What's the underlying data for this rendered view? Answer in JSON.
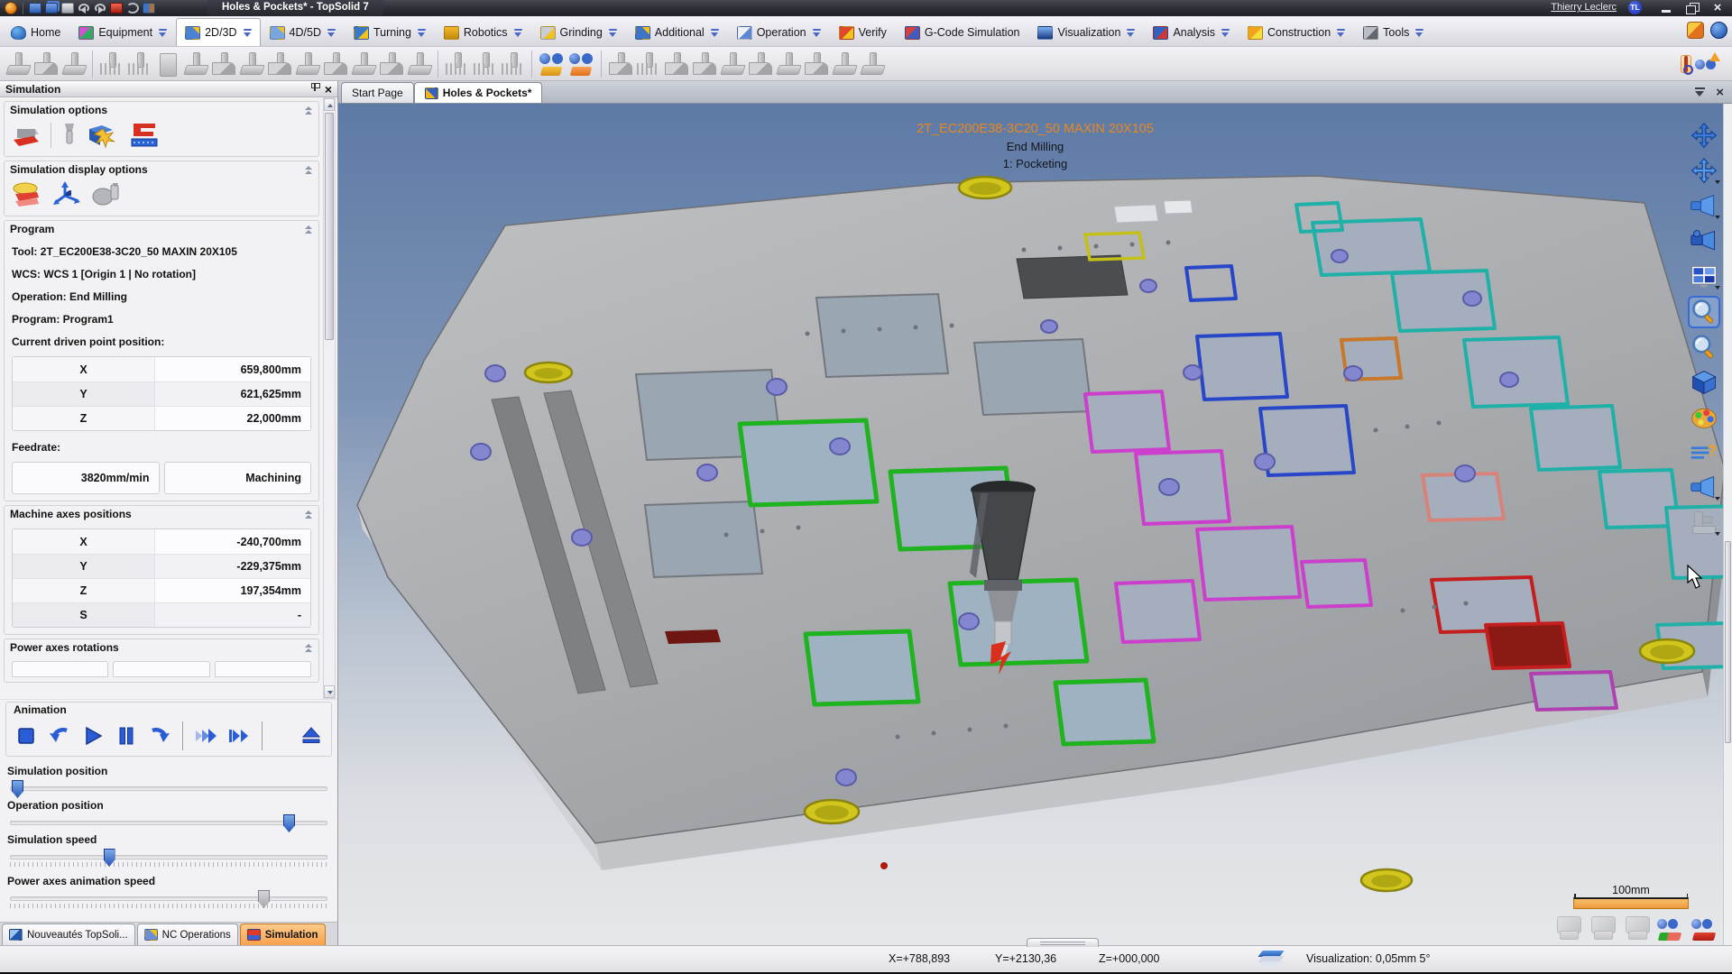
{
  "window": {
    "title": "Holes & Pockets* - TopSolid 7",
    "user_name": "Thierry Leclerc",
    "user_initials": "TL"
  },
  "quick_access_icons": [
    "topsolid-logo",
    "save",
    "save-all",
    "print",
    "undo",
    "redo",
    "export",
    "refresh",
    "exit-document"
  ],
  "ribbon": {
    "tabs": [
      {
        "label": "Home",
        "icon": "home-tab-icon",
        "has_dropdown": false
      },
      {
        "label": "Equipment",
        "icon": "equipment-tab-icon",
        "has_dropdown": true
      },
      {
        "label": "2D/3D",
        "icon": "2d3d-tab-icon",
        "has_dropdown": true,
        "active": true
      },
      {
        "label": "4D/5D",
        "icon": "4d5d-tab-icon",
        "has_dropdown": true
      },
      {
        "label": "Turning",
        "icon": "turning-tab-icon",
        "has_dropdown": true
      },
      {
        "label": "Robotics",
        "icon": "robotics-tab-icon",
        "has_dropdown": true
      },
      {
        "label": "Grinding",
        "icon": "grinding-tab-icon",
        "has_dropdown": true
      },
      {
        "label": "Additional",
        "icon": "additional-tab-icon",
        "has_dropdown": true
      },
      {
        "label": "Operation",
        "icon": "operation-tab-icon",
        "has_dropdown": true
      },
      {
        "label": "Verify",
        "icon": "verify-tab-icon",
        "has_dropdown": false
      },
      {
        "label": "G-Code Simulation",
        "icon": "gcode-simulation-tab-icon",
        "has_dropdown": false
      },
      {
        "label": "Visualization",
        "icon": "visualization-tab-icon",
        "has_dropdown": true
      },
      {
        "label": "Analysis",
        "icon": "analysis-tab-icon",
        "has_dropdown": true
      },
      {
        "label": "Construction",
        "icon": "construction-tab-icon",
        "has_dropdown": true
      },
      {
        "label": "Tools",
        "icon": "tools-tab-icon",
        "has_dropdown": true
      }
    ],
    "corner_icons": [
      "customize-icon",
      "about-icon"
    ]
  },
  "toolbar": {
    "gray_icon_names": [
      "milling-icon-1",
      "milling-icon-2",
      "milling-icon-3",
      "pattern-icon-1",
      "pattern-icon-2",
      "options-icon",
      "tool-icon-1",
      "tool-icon-2",
      "tool-icon-3",
      "tool-icon-4",
      "tool-icon-5",
      "tool-icon-6",
      "tool-icon-7",
      "tool-icon-8",
      "tool-icon-9",
      "drill-icon-1",
      "drill-icon-2",
      "drill-icon-3",
      "surface-icon-1",
      "surface-icon-2",
      "surface-icon-3",
      "surface-icon-4",
      "surface-icon-5",
      "surface-icon-6",
      "surface-icon-7",
      "surface-icon-8",
      "saddle-icon-1",
      "saddle-icon-2"
    ],
    "color_icon_names": [
      "toolpath-binoculars-icon",
      "stock-binoculars-icon"
    ],
    "right_icons": [
      "tag-icon",
      "watch-up-icon"
    ]
  },
  "doc_tabs": {
    "tabs": [
      {
        "label": "Start Page"
      },
      {
        "label": "Holes & Pockets*",
        "active": true
      }
    ],
    "controls": [
      "tab-list-icon",
      "close-document-icon"
    ]
  },
  "sim_panel": {
    "title": "Simulation",
    "options_label": "Simulation options",
    "options_icons": [
      "machining-simulation-icon",
      "tool-only-icon",
      "collision-check-icon",
      "material-removal-icon"
    ],
    "display_options_label": "Simulation display options",
    "display_icons": [
      "stock-display-icon",
      "axes-display-icon",
      "tool-display-icon"
    ],
    "program_label": "Program",
    "program": {
      "tool": "Tool: 2T_EC200E38-3C20_50 MAXIN 20X105",
      "wcs": "WCS: WCS 1 [Origin 1 | No rotation]",
      "operation": "Operation: End Milling",
      "program": "Program: Program1",
      "driven_point_label": "Current driven point position:"
    },
    "driven_point_table": {
      "rows": [
        {
          "axis": "X",
          "value": "659,800mm"
        },
        {
          "axis": "Y",
          "value": "621,625mm"
        },
        {
          "axis": "Z",
          "value": "22,000mm"
        }
      ]
    },
    "feedrate": {
      "label": "Feedrate:",
      "value": "3820mm/min",
      "mode": "Machining"
    },
    "machine_axes_label": "Machine axes positions",
    "machine_axes_table": {
      "rows": [
        {
          "axis": "X",
          "value": "-240,700mm"
        },
        {
          "axis": "Y",
          "value": "-229,375mm"
        },
        {
          "axis": "Z",
          "value": "197,354mm"
        },
        {
          "axis": "S",
          "value": "-"
        }
      ]
    },
    "power_axes_label": "Power axes rotations",
    "animation_label": "Animation",
    "animation_buttons": [
      "stop",
      "rewind",
      "play",
      "pause",
      "resume",
      "fast-forward",
      "next-operation",
      "eject"
    ],
    "sliders": [
      {
        "label": "Simulation position",
        "value_pct": 2
      },
      {
        "label": "Operation position",
        "value_pct": 88
      },
      {
        "label": "Simulation speed",
        "value_pct": 31
      },
      {
        "label": "Power axes animation speed",
        "value_pct": 80
      }
    ],
    "bottom_tabs": [
      {
        "label": "Nouveautés TopSoli..."
      },
      {
        "label": "NC Operations"
      },
      {
        "label": "Simulation",
        "active": true
      }
    ]
  },
  "viewport": {
    "overlay": {
      "tool_name": "2T_EC200E38-3C20_50 MAXIN 20X105",
      "operation": "End Milling",
      "step": "1: Pocketing"
    },
    "scale_label": "100mm",
    "right_toolbar_icons": [
      "pan-icon",
      "orbit-icon",
      "view-direction-icon",
      "camera-icon",
      "viewports-layout-icon",
      "zoom-window-icon",
      "zoom-icon",
      "isometric-view-icon",
      "render-style-icon",
      "help-notes-icon",
      "view-direction-2-icon",
      "machine-display-icon"
    ],
    "bottom_right_icons": [
      "machine-ghost-icon",
      "stock-ghost-icon",
      "part-ghost-icon",
      "watch-toolpath-icon",
      "watch-removal-icon"
    ],
    "colors": {
      "background_top": "#5d7aa6",
      "background_bottom": "#e6e7ea",
      "plate_gray": "#aaacaf",
      "overlay_orange": "#e8871e",
      "pocket_green": "#1fb41f",
      "pocket_magenta": "#cc3ecc",
      "pocket_blue": "#2846c8",
      "pocket_teal": "#1fb0a8",
      "pocket_red": "#c41e1e",
      "hole_yellow": "#d2c61c",
      "hole_purple": "#8486d0"
    }
  },
  "status_bar": {
    "x": "X=+788,893",
    "y": "Y=+2130,36",
    "z": "Z=+000,000",
    "visualization": "Visualization: 0,05mm 5°"
  }
}
